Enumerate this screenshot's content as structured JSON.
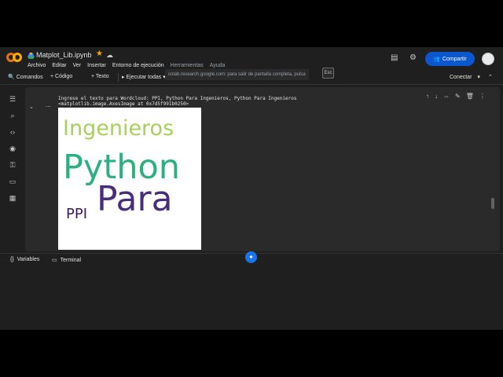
{
  "header": {
    "title": "Matplot_Lib.ipynb",
    "menu": [
      "Archivo",
      "Editar",
      "Ver",
      "Insertar",
      "Entorno de ejecución",
      "Herramientas",
      "Ayuda"
    ],
    "share_label": "Compartir",
    "fullscreen_tip": "colab.research.google.com: para salir de pantalla completa, pulsa",
    "esc_key": "Esc"
  },
  "toolbar": {
    "commands": "Comandos",
    "code": "+ Código",
    "text": "+ Texto",
    "run_all": "Ejecutar todas",
    "connect": "Conectar"
  },
  "cell": {
    "output_line1": "Ingrese el texto para Wordcloud: PPI, Python Para Ingenieros, Python Para Ingenieros",
    "output_line2": "<matplotlib.image.AxesImage at 0x7d5f991b0250>"
  },
  "wordcloud": {
    "words": [
      {
        "text": "Ingenieros",
        "color": "#a8d05a"
      },
      {
        "text": "Python",
        "color": "#2bb07f"
      },
      {
        "text": "Para",
        "color": "#472d7b"
      },
      {
        "text": "PPI",
        "color": "#3d1a5e"
      }
    ]
  },
  "bottom": {
    "variables": "Variables",
    "terminal": "Terminal"
  },
  "colors": {
    "accent": "#0b57d0",
    "background": "#1f1f1f",
    "cell": "#2a2a2a"
  }
}
